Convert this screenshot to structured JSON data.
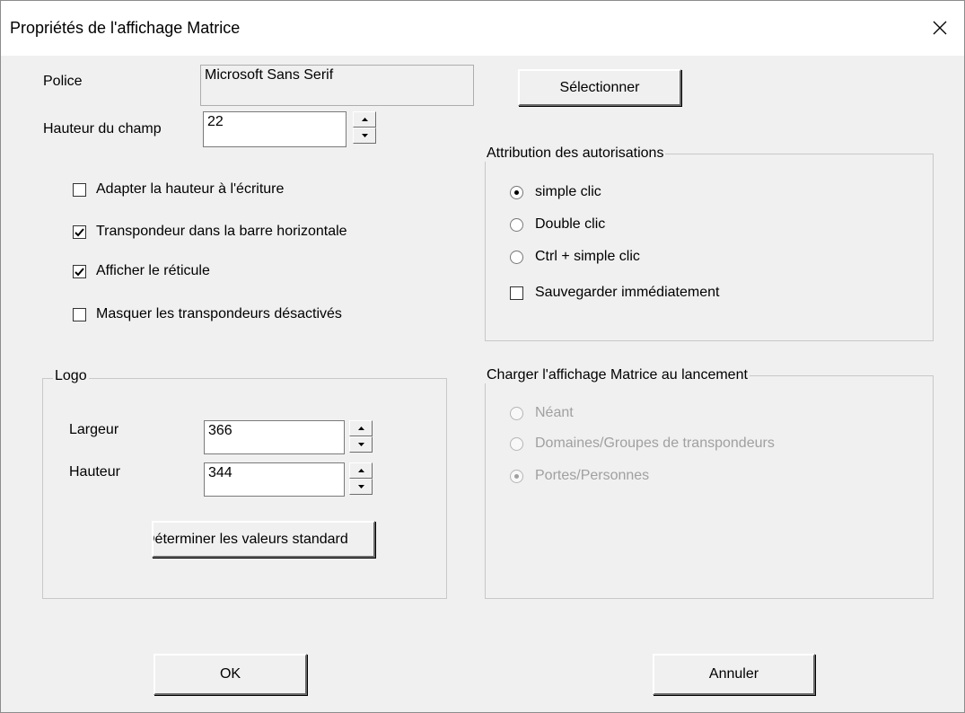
{
  "window": {
    "title": "Propriétés de l'affichage Matrice"
  },
  "font": {
    "label": "Police",
    "value": "Microsoft Sans Serif",
    "select_button": "Sélectionner"
  },
  "row_height": {
    "label": "Hauteur du champ",
    "value": "22"
  },
  "options": [
    {
      "label": "Adapter la hauteur à l'écriture",
      "checked": false
    },
    {
      "label": "Transpondeur dans la barre horizontale",
      "checked": true
    },
    {
      "label": "Afficher le réticule",
      "checked": true
    },
    {
      "label": "Masquer les transpondeurs désactivés",
      "checked": false
    }
  ],
  "logo": {
    "title": "Logo",
    "width_label": "Largeur",
    "width_value": "366",
    "height_label": "Hauteur",
    "height_value": "344",
    "defaults_button": "Déterminer les valeurs standard"
  },
  "authorization": {
    "title": "Attribution des autorisations",
    "radios": [
      {
        "label": "simple clic",
        "selected": true
      },
      {
        "label": "Double clic",
        "selected": false
      },
      {
        "label": "Ctrl + simple clic",
        "selected": false
      }
    ],
    "save_immediately": {
      "label": "Sauvegarder immédiatement",
      "checked": false
    }
  },
  "startup": {
    "title": "Charger l'affichage Matrice au lancement",
    "radios": [
      {
        "label": "Néant",
        "selected": false
      },
      {
        "label": "Domaines/Groupes de transpondeurs",
        "selected": false
      },
      {
        "label": "Portes/Personnes",
        "selected": true
      }
    ]
  },
  "buttons": {
    "ok": "OK",
    "cancel": "Annuler"
  },
  "icons": {
    "close": "close-icon",
    "check": "checkmark-icon",
    "spin_up": "arrow-up-icon",
    "spin_down": "arrow-down-icon"
  }
}
